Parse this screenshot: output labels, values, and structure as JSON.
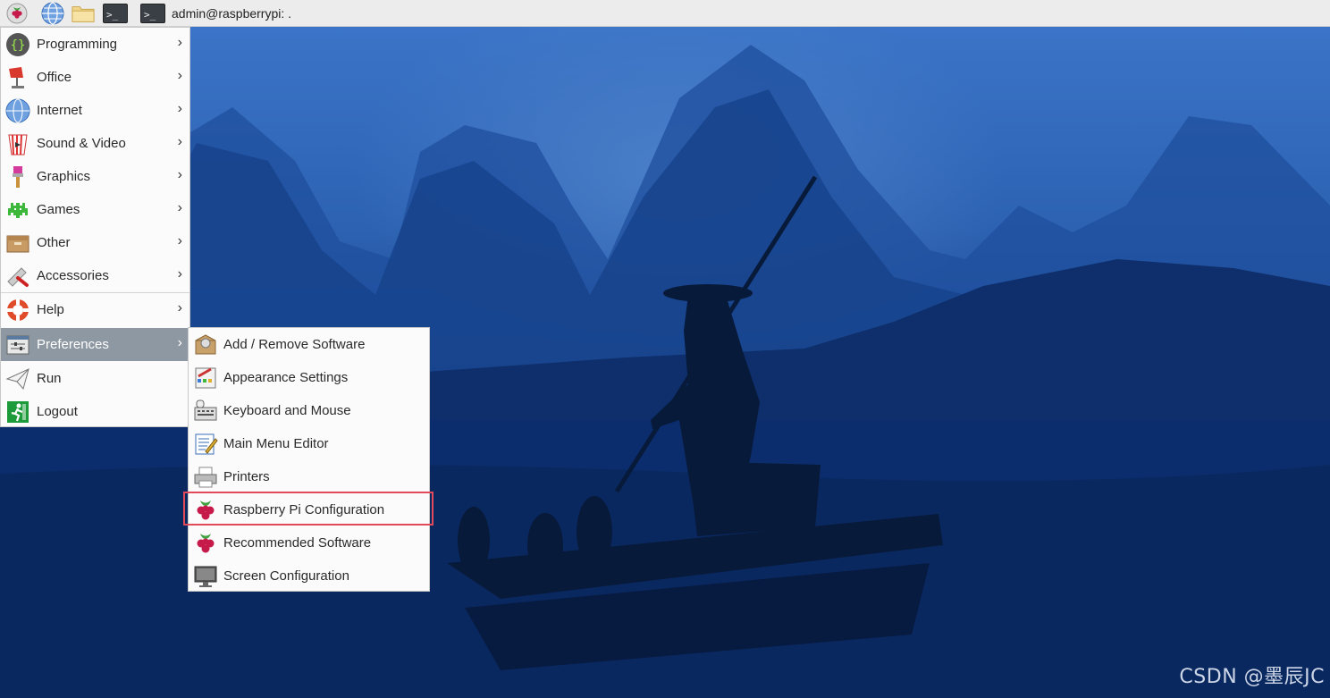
{
  "taskbar": {
    "window_title": "admin@raspberrypi: .",
    "icons": [
      "raspberry-menu-icon",
      "browser-globe-icon",
      "file-manager-folder-icon",
      "terminal-icon",
      "terminal-window-icon"
    ],
    "terminal_glyph": ">_"
  },
  "main_menu": {
    "items": [
      {
        "label": "Programming",
        "icon": "programming-icon"
      },
      {
        "label": "Office",
        "icon": "office-icon"
      },
      {
        "label": "Internet",
        "icon": "internet-globe-icon"
      },
      {
        "label": "Sound & Video",
        "icon": "sound-video-icon"
      },
      {
        "label": "Graphics",
        "icon": "graphics-brush-icon"
      },
      {
        "label": "Games",
        "icon": "games-invader-icon"
      },
      {
        "label": "Other",
        "icon": "other-box-icon"
      },
      {
        "label": "Accessories",
        "icon": "accessories-knife-icon"
      },
      {
        "label": "Help",
        "icon": "help-lifebuoy-icon"
      },
      {
        "label": "Preferences",
        "icon": "preferences-icon",
        "active": true
      },
      {
        "label": "Run",
        "icon": "run-paper-plane-icon"
      },
      {
        "label": "Logout",
        "icon": "logout-exit-icon"
      }
    ],
    "arrow": "›"
  },
  "preferences_submenu": {
    "items": [
      {
        "label": "Add / Remove Software",
        "icon": "package-icon"
      },
      {
        "label": "Appearance Settings",
        "icon": "appearance-icon"
      },
      {
        "label": "Keyboard and Mouse",
        "icon": "keyboard-mouse-icon"
      },
      {
        "label": "Main Menu Editor",
        "icon": "menu-editor-icon"
      },
      {
        "label": "Printers",
        "icon": "printer-icon"
      },
      {
        "label": "Raspberry Pi Configuration",
        "icon": "raspberry-icon",
        "highlighted": true
      },
      {
        "label": "Recommended Software",
        "icon": "raspberry-icon"
      },
      {
        "label": "Screen Configuration",
        "icon": "monitor-icon"
      }
    ]
  },
  "colors": {
    "highlight_border": "#e24a5a",
    "active_item_bg": "#8d98a3"
  },
  "watermark": "CSDN @墨辰JC"
}
